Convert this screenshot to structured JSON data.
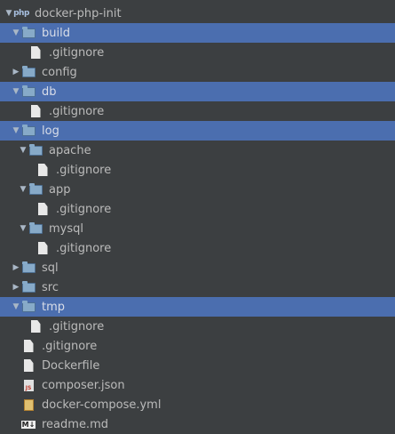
{
  "tree": [
    {
      "label": "docker-php-init",
      "depth": 0,
      "type": "project",
      "icon": "php-icon",
      "expanded": true,
      "selected": false
    },
    {
      "label": "build",
      "depth": 1,
      "type": "folder",
      "expanded": true,
      "selected": true
    },
    {
      "label": ".gitignore",
      "depth": 2,
      "type": "file"
    },
    {
      "label": "config",
      "depth": 1,
      "type": "folder",
      "expanded": false
    },
    {
      "label": "db",
      "depth": 1,
      "type": "folder",
      "expanded": true,
      "selected": true
    },
    {
      "label": ".gitignore",
      "depth": 2,
      "type": "file"
    },
    {
      "label": "log",
      "depth": 1,
      "type": "folder",
      "expanded": true,
      "selected": true
    },
    {
      "label": "apache",
      "depth": 2,
      "type": "folder",
      "expanded": true
    },
    {
      "label": ".gitignore",
      "depth": 3,
      "type": "file"
    },
    {
      "label": "app",
      "depth": 2,
      "type": "folder",
      "expanded": true
    },
    {
      "label": ".gitignore",
      "depth": 3,
      "type": "file"
    },
    {
      "label": "mysql",
      "depth": 2,
      "type": "folder",
      "expanded": true
    },
    {
      "label": ".gitignore",
      "depth": 3,
      "type": "file"
    },
    {
      "label": "sql",
      "depth": 1,
      "type": "folder",
      "expanded": false
    },
    {
      "label": "src",
      "depth": 1,
      "type": "folder",
      "expanded": false
    },
    {
      "label": "tmp",
      "depth": 1,
      "type": "folder",
      "expanded": true,
      "selected": true
    },
    {
      "label": ".gitignore",
      "depth": 2,
      "type": "file"
    },
    {
      "label": ".gitignore",
      "depth": 1,
      "type": "file"
    },
    {
      "label": "Dockerfile",
      "depth": 1,
      "type": "file"
    },
    {
      "label": "composer.json",
      "depth": 1,
      "type": "json"
    },
    {
      "label": "docker-compose.yml",
      "depth": 1,
      "type": "yml"
    },
    {
      "label": "readme.md",
      "depth": 1,
      "type": "md"
    }
  ],
  "colors": {
    "background": "#3c3f41",
    "selection": "#4b6eaf",
    "text": "#bbbbbb"
  }
}
